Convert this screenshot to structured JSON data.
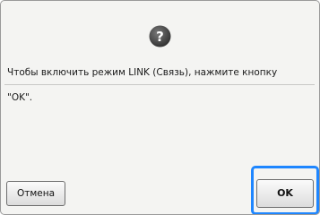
{
  "dialog": {
    "icon": "question-icon",
    "message_line1": "Чтобы включить режим LINK (Связь), нажмите кнопку",
    "message_line2": "\"OK\"."
  },
  "buttons": {
    "cancel_label": "Отмена",
    "ok_label": "OK"
  },
  "colors": {
    "highlight": "#1e86ff",
    "icon_fill": "#4a4a4a"
  }
}
